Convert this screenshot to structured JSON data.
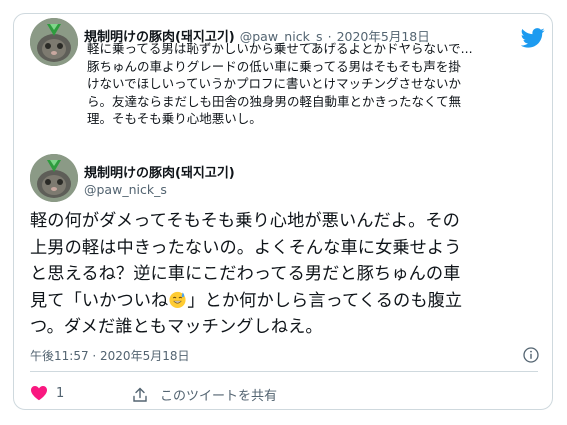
{
  "quoted": {
    "display_name": "規制明けの豚肉(돼지고기)",
    "handle": "@paw_nick_s",
    "separator": "·",
    "date": "2020年5月18日",
    "lines": [
      "軽に乗ってる男は恥ずかしいから乗せてあげるよとかドヤらないで...",
      "豚ちゅんの車よりグレードの低い車に乗ってる男はそもそも声を掛",
      "けないでほしいっていうかプロフに書いとけマッチングさせないか",
      "ら。友達ならまだしも田舎の独身男の軽自動車とかきったなくて無",
      "理。そもそも乗り心地悪いし。"
    ]
  },
  "tweet": {
    "display_name": "規制明けの豚肉(돼지고기)",
    "handle": "@paw_nick_s",
    "lines": [
      "軽の何がダメってそもそも乗り心地が悪いんだよ。その",
      "上男の軽は中きったないの。よくそんな車に女乗せよう",
      "と思えるね？逆に車にこだわってる男だと豚ちゅんの車"
    ],
    "line4_before": "見て「いかついね",
    "line4_after": "」とか何かしら言ってくるのも腹立",
    "line5": "つ。ダメだ誰ともマッチングしねえ。",
    "emoji": "sweat-smile-emoji",
    "timestamp": "午後11:57 · 2020年5月18日"
  },
  "actions": {
    "like_count": "1",
    "share_label": "このツイートを共有"
  },
  "colors": {
    "twitter_blue": "#1d9bf0",
    "like_red": "#f91880",
    "secondary_text": "#536471",
    "border": "#cfd9de"
  }
}
